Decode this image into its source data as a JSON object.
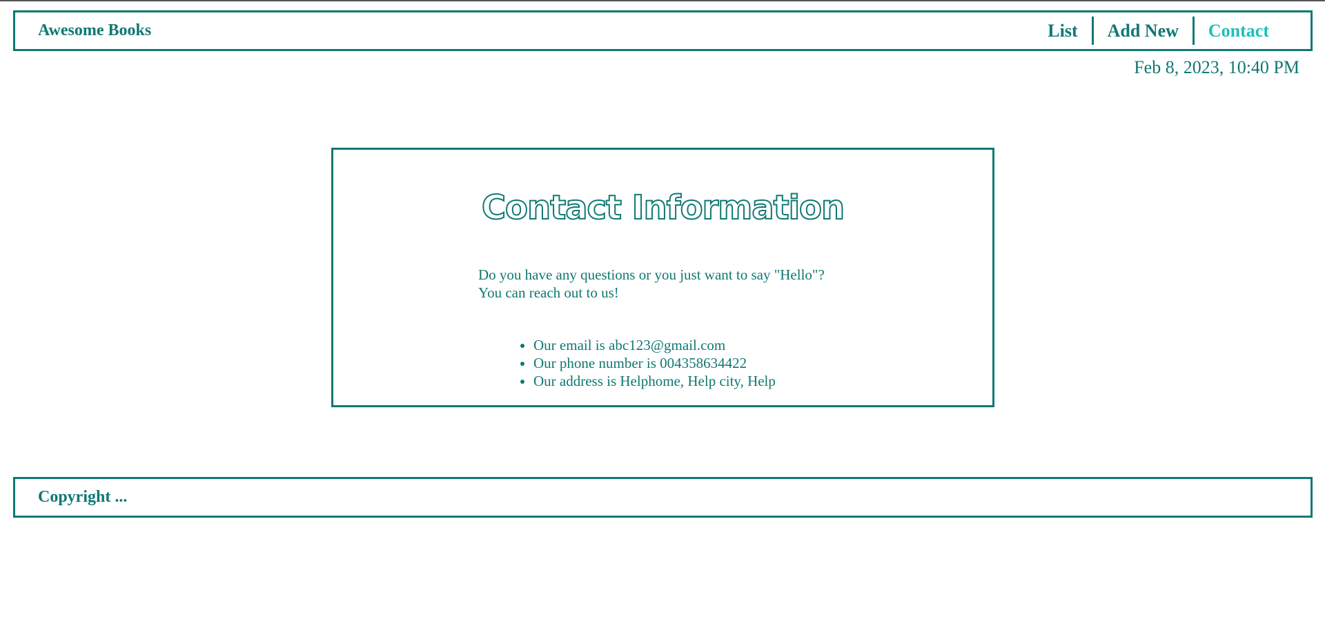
{
  "header": {
    "brand": "Awesome Books",
    "nav": [
      {
        "label": "List",
        "active": false
      },
      {
        "label": "Add New",
        "active": false
      },
      {
        "label": "Contact",
        "active": true
      }
    ],
    "datetime": "Feb 8, 2023, 10:40 PM"
  },
  "contact": {
    "title": "Contact Information",
    "intro_line1": "Do you have any questions or you just want to say \"Hello\"?",
    "intro_line2": "You can reach out to us!",
    "items": [
      "Our email is abc123@gmail.com",
      "Our phone number is 004358634422",
      "Our address is Helphome, Help city, Help"
    ]
  },
  "footer": {
    "copyright": "Copyright ..."
  },
  "colors": {
    "primary": "#0f7873",
    "active_link": "#1cbfba",
    "background": "#ffffff"
  }
}
